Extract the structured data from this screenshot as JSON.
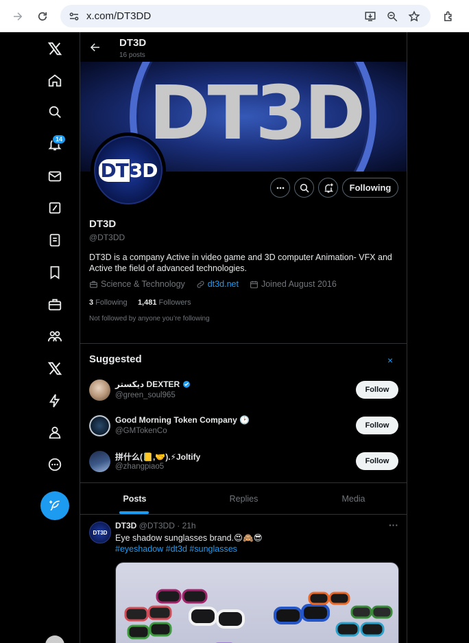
{
  "browser": {
    "url": "x.com/DT3DD"
  },
  "sidebar": {
    "notifications_badge": "14",
    "items": [
      "x-logo",
      "home",
      "explore",
      "notifications",
      "messages",
      "grok",
      "lists",
      "bookmarks",
      "jobs",
      "communities",
      "premium",
      "verified-orgs",
      "profile",
      "more"
    ]
  },
  "header": {
    "name": "DT3D",
    "posts_count": "16 posts"
  },
  "banner": {
    "text": "DT3D"
  },
  "avatar": {
    "text_d": "DT",
    "text_rest": "3D"
  },
  "profile": {
    "name": "DT3D",
    "handle": "@DT3DD",
    "bio": "DT3D is a company Active in video game and 3D computer Animation- VFX and Active the field of advanced technologies.",
    "category": "Science & Technology",
    "website": "dt3d.net",
    "joined": "Joined August 2016",
    "following_count": "3",
    "following_label": "Following",
    "followers_count": "1,481",
    "followers_label": "Followers",
    "not_followed": "Not followed by anyone you’re following",
    "following_button": "Following"
  },
  "suggested": {
    "title": "Suggested",
    "close": "×",
    "items": [
      {
        "name": "دیکستر DEXTER",
        "handle": "@green_soul965",
        "button": "Follow"
      },
      {
        "name": "Good Morning Token Company 🕑",
        "handle": "@GMTokenCo",
        "button": "Follow"
      },
      {
        "name": "拼什么(📒,🤝).⚡Joltify",
        "handle": "@zhangpiao5",
        "button": "Follow"
      }
    ]
  },
  "tabs": [
    {
      "label": "Posts",
      "active": true
    },
    {
      "label": "Replies",
      "active": false
    },
    {
      "label": "Media",
      "active": false
    }
  ],
  "tweet": {
    "name": "DT3D",
    "handle": "@DT3DD",
    "time": "21h",
    "text": "Eye shadow sunglasses brand.😍🙈😎",
    "hashtags": "#eyeshadow #dt3d #sunglasses",
    "more": "···",
    "avatar_text": "DT3D"
  },
  "colors": {
    "accent": "#1d9bf0",
    "background": "#000000",
    "muted": "#71767b"
  }
}
